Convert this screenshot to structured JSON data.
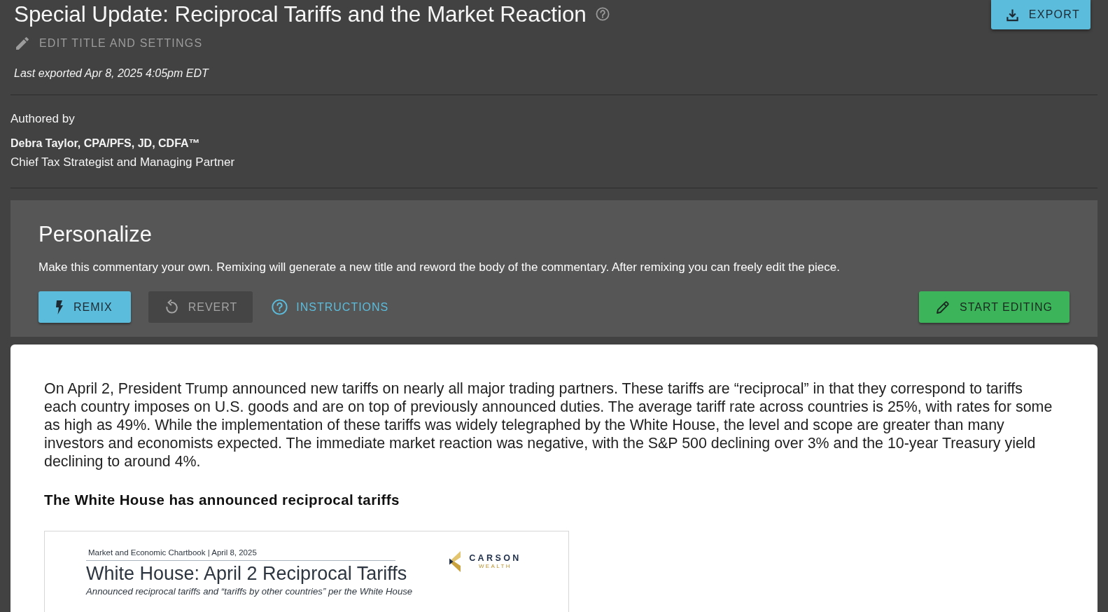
{
  "header": {
    "title": "Special Update: Reciprocal Tariffs and the Market Reaction",
    "edit_link": "EDIT TITLE AND SETTINGS",
    "last_exported": "Last exported Apr 8, 2025 4:05pm EDT",
    "export_button": "EXPORT"
  },
  "author": {
    "heading": "Authored by",
    "name": "Debra Taylor, CPA/PFS, JD, CDFA™",
    "role": "Chief Tax Strategist and Managing Partner"
  },
  "personalize": {
    "title": "Personalize",
    "description": "Make this commentary your own. Remixing will generate a new title and reword the body of the commentary. After remixing you can freely edit the piece.",
    "buttons": [
      {
        "kind": "remix",
        "label": "REMIX",
        "disabled": false
      },
      {
        "kind": "revert",
        "label": "REVERT",
        "disabled": true
      },
      {
        "kind": "instructions",
        "label": "INSTRUCTIONS",
        "disabled": false
      },
      {
        "kind": "edit",
        "label": "START EDITING",
        "disabled": false
      }
    ]
  },
  "article": {
    "paragraph": "On April 2, President Trump announced new tariffs on nearly all major trading partners. These tariffs are “reciprocal” in that they correspond to tariffs each country imposes on U.S. goods and are on top of previously announced duties. The average tariff rate across countries is 25%, with rates for some as high as 49%. While the implementation of these tariffs was widely telegraphed by the White House, the level and scope are greater than many investors and economists expected. The immediate market reaction was negative, with the S&P 500 declining over 3% and the 10-year Treasury yield declining to around 4%.",
    "heading": "The White House has announced reciprocal tariffs",
    "figure": {
      "kicker": "Market and Economic Chartbook | April 8, 2025",
      "title": "White House: April 2 Reciprocal Tariffs",
      "subtitle": "Announced reciprocal tariffs and “tariffs by other countries” per the White House",
      "logo_wordmark": "CARSON",
      "logo_tagline": "WEALTH"
    }
  }
}
